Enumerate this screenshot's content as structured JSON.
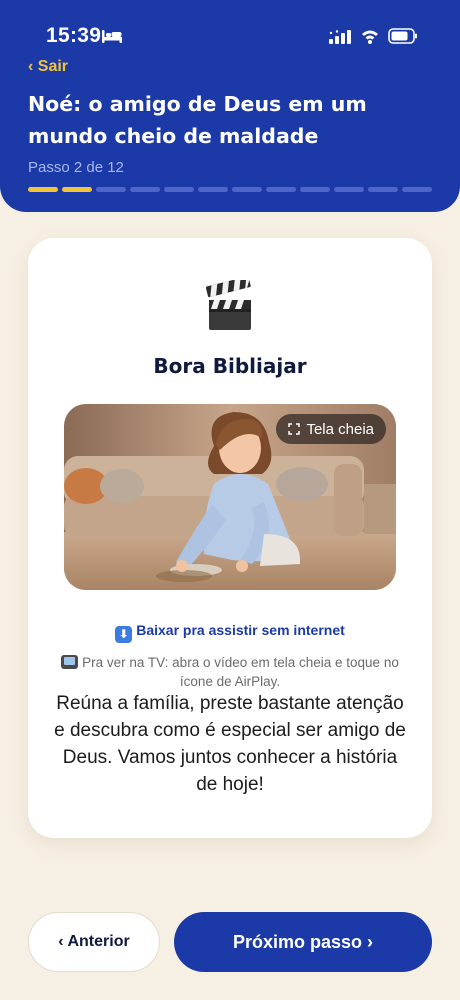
{
  "status_bar": {
    "time": "15:39"
  },
  "header": {
    "back_label": "‹ Sair",
    "title": "Noé: o amigo de Deus em um mundo cheio de maldade",
    "step_label": "Passo 2 de 12",
    "progress": {
      "current_step": 2,
      "total_steps": 12
    }
  },
  "card": {
    "icon": "clapper-board-icon",
    "title": "Bora Bibliajar",
    "video": {
      "fullscreen_label": "Tela cheia"
    },
    "download_label": "Baixar pra assistir sem internet",
    "tv_hint": "Pra ver na TV: abra o vídeo em tela cheia e toque no ícone de AirPlay.",
    "body_text": "Reúna a família, preste bastante atenção e descubra como é especial ser amigo de Deus. Vamos juntos conhecer a história de hoje!"
  },
  "footer": {
    "prev_label": "‹ Anterior",
    "next_label": "Próximo passo ›"
  },
  "colors": {
    "header_blue": "#1b3aa8",
    "accent_yellow": "#f2c43b",
    "background": "#f6efe3"
  }
}
